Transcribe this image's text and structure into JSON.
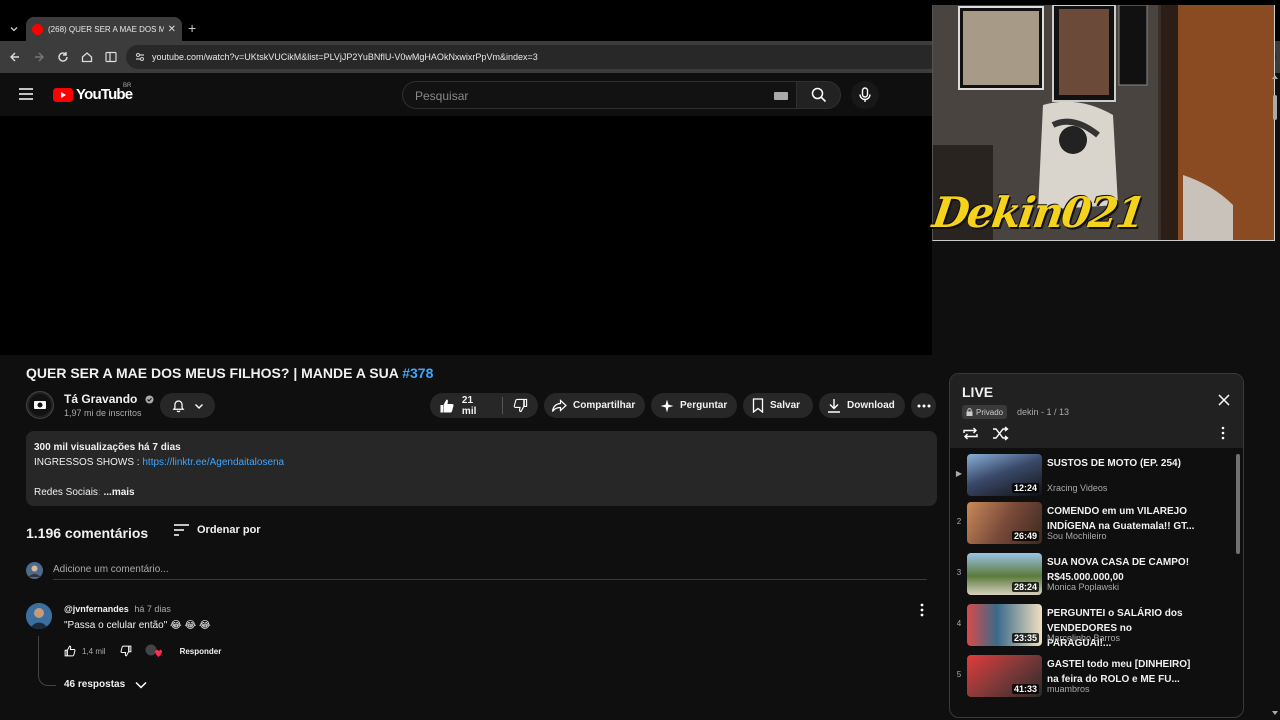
{
  "browser": {
    "tab_title": "(268) QUER SER A MAE DOS M",
    "url": "youtube.com/watch?v=UKtskVUCikM&list=PLVjJP2YuBNflU-V0wMgHAOkNxwixrPpVm&index=3"
  },
  "header": {
    "logo_text": "YouTube",
    "country": "BR",
    "search_placeholder": "Pesquisar"
  },
  "webcam": {
    "overlay_name": "Dekin021"
  },
  "video": {
    "title": "QUER SER A MAE DOS MEUS FILHOS? | MANDE A SUA",
    "hashtag": "#378",
    "channel_name": "Tá Gravando",
    "subscribers": "1,97 mi de inscritos",
    "likes": "21 mil",
    "share_label": "Compartilhar",
    "ask_label": "Perguntar",
    "save_label": "Salvar",
    "download_label": "Download"
  },
  "description": {
    "stats": "300 mil visualizações  há 7 dias",
    "tickets_label": "INGRESSOS SHOWS : ",
    "tickets_link": "https://linktr.ee/Agendaitalosena",
    "social_label": "Redes Sociais",
    "more_label": "...mais"
  },
  "comments": {
    "count_label": "1.196 comentários",
    "sort_label": "Ordenar por",
    "add_placeholder": "Adicione um comentário...",
    "items": [
      {
        "author": "@jvnfernandes",
        "time": "há 7 dias",
        "text": "\"Passa o celular então\" 😂 😂 😂",
        "likes": "1,4 mil",
        "reply_label": "Responder",
        "replies_label": "46 respostas"
      }
    ]
  },
  "playlist": {
    "title": "LIVE",
    "privacy": "Privado",
    "meta": "dekin - 1 / 13",
    "items": [
      {
        "index": "▶",
        "title": "SUSTOS DE MOTO (EP. 254)",
        "channel": "Xracing Videos",
        "duration": "12:24",
        "thumb_color": "#3b4a6b"
      },
      {
        "index": "2",
        "title": "COMENDO em um VILAREJO INDÍGENA na Guatemala!! GT...",
        "channel": "Sou Mochileiro",
        "duration": "26:49",
        "thumb_color": "#7a4a3a"
      },
      {
        "index": "3",
        "title": "SUA NOVA CASA DE CAMPO! R$45.000.000,00",
        "channel": "Monica Poplawski",
        "duration": "28:24",
        "thumb_color": "#5b7a3a"
      },
      {
        "index": "4",
        "title": "PERGUNTEI o SALÁRIO dos VENDEDORES no PARAGUAI!...",
        "channel": "Marcelinho Barros",
        "duration": "23:35",
        "thumb_color": "#3a6b8a"
      },
      {
        "index": "5",
        "title": "GASTEI todo meu [DINHEIRO] na feira do ROLO e ME FU...",
        "channel": "muambros",
        "duration": "41:33",
        "thumb_color": "#8a3a3a"
      }
    ]
  }
}
